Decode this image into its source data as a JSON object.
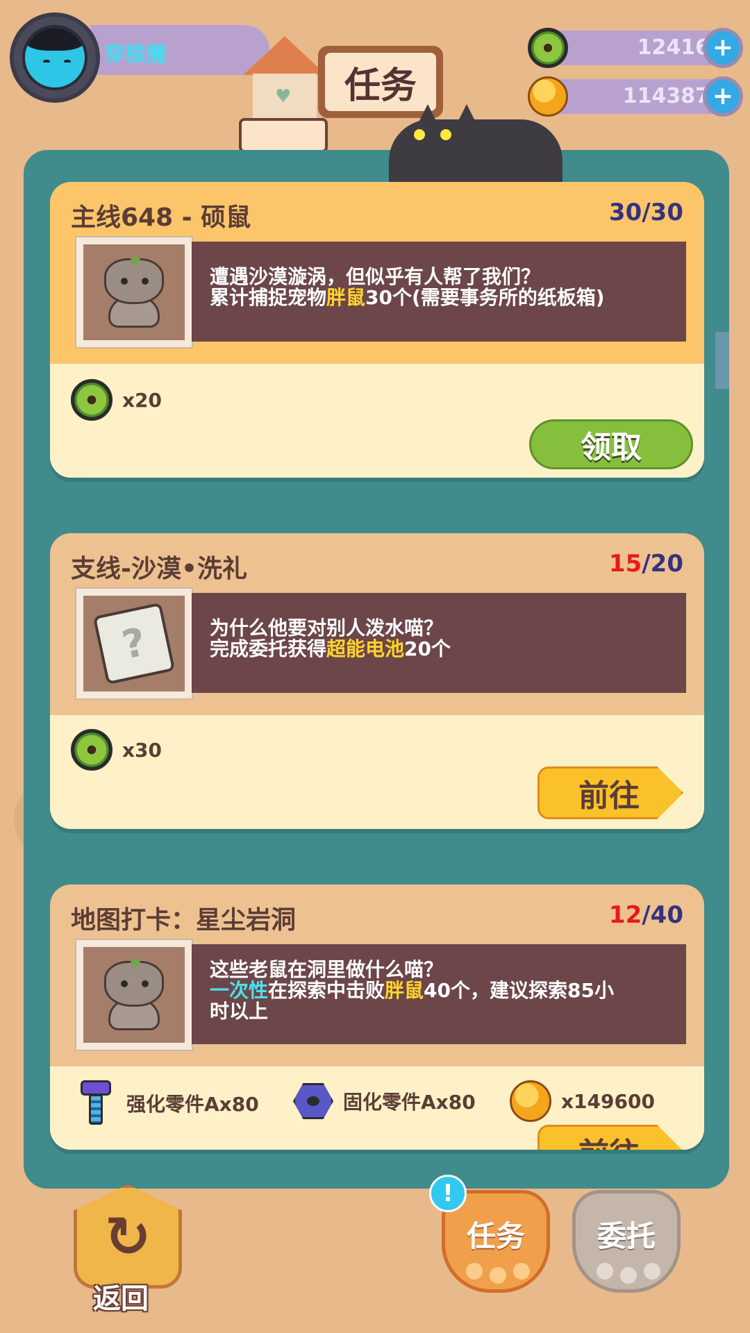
{
  "player": {
    "name": "穿梭魔"
  },
  "header": {
    "title": "任务"
  },
  "currency": {
    "donut": {
      "value": "12416",
      "icon": "donut-currency-icon"
    },
    "coin": {
      "value": "114387",
      "icon": "gold-coin-icon"
    }
  },
  "tasks": [
    {
      "title": "主线648 - 硕鼠",
      "progress_current": "30",
      "progress_sep": "/",
      "progress_total": "30",
      "desc_line1": "遭遇沙漠漩涡，但似乎有人帮了我们？",
      "desc_line2_pre": "累计捕捉宠物",
      "desc_line2_hl": "胖鼠",
      "desc_line2_post": "30个(需要事务所的纸板箱)",
      "reward_amount": "x20",
      "button": "领取",
      "top_color": "#fdc56a"
    },
    {
      "title": "支线-沙漠•洗礼",
      "progress_current": "15",
      "progress_sep": "/",
      "progress_total": "20",
      "desc_line1": "为什么他要对别人泼水喵？",
      "desc_line2_pre": "完成委托获得",
      "desc_line2_hl": "超能电池",
      "desc_line2_post": "20个",
      "reward_amount": "x30",
      "button": "前往",
      "top_color": "#eec191"
    },
    {
      "title": "地图打卡：星尘岩洞",
      "progress_current": "12",
      "progress_sep": "/",
      "progress_total": "40",
      "desc_line1": "这些老鼠在洞里做什么喵？",
      "desc_line2_hl_cyan": "一次性",
      "desc_line2_pre": "在探索中击败",
      "desc_line2_hl": "胖鼠",
      "desc_line2_post": "40个，建议探索85小",
      "desc_line3": "时以上",
      "reward1": "强化零件Ax80",
      "reward2": "固化零件Ax80",
      "reward3": "x149600",
      "button": "前往",
      "top_color": "#eec191"
    }
  ],
  "nav": {
    "back": "返回",
    "tab_tasks": "任务",
    "tab_commission": "委托",
    "notify_badge": "!"
  },
  "colors": {
    "board": "#408b8b",
    "background": "#e8b98a",
    "claim_button": "#86bf3c",
    "go_button": "#fbc12a",
    "progress_done": "#33337e",
    "progress_incomplete": "#e81b17"
  }
}
